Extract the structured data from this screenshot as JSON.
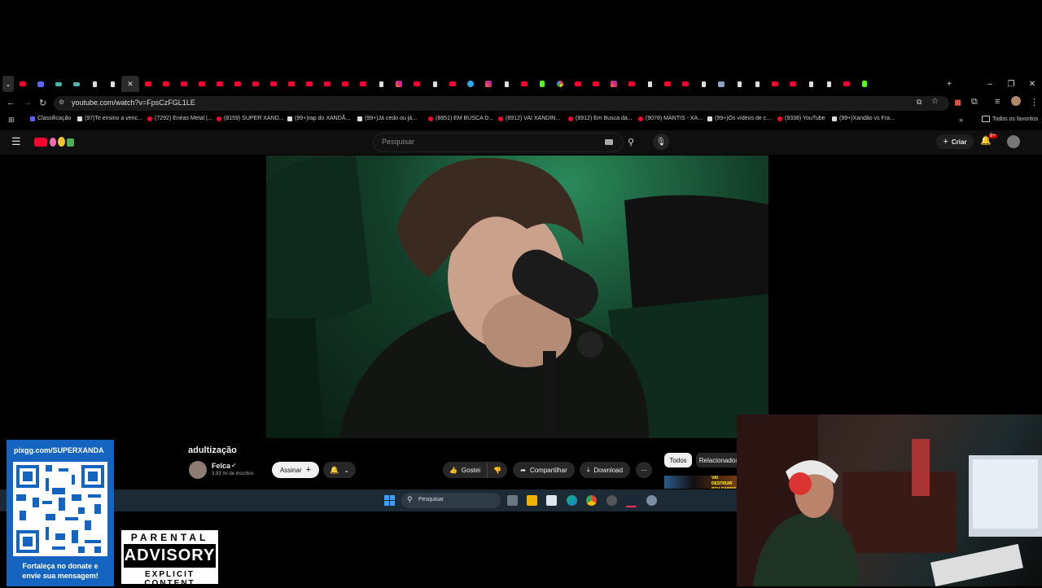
{
  "browser": {
    "tabs": [
      "yt",
      "dc",
      "ed",
      "ed",
      "tt",
      "tt",
      "close",
      "yt",
      "yt",
      "yt",
      "yt",
      "yt",
      "yt",
      "yt",
      "yt",
      "yt",
      "yt",
      "yt",
      "yt",
      "yt",
      "tt",
      "ig",
      "yt",
      "tt",
      "yt",
      "tg",
      "ig",
      "tt",
      "yt",
      "k",
      "g",
      "yt",
      "yt",
      "ig",
      "yt",
      "tt",
      "yt",
      "yt",
      "tt",
      "ms",
      "tt",
      "tt",
      "yt",
      "yt",
      "tt",
      "tt",
      "yt",
      "k"
    ],
    "active_tab_glyph": "✕",
    "new_tab": "+",
    "window_controls": {
      "minimize": "–",
      "maximize": "❐",
      "close": "✕"
    },
    "url": "youtube.com/watch?v=FpsCzFGL1LE",
    "bookmarks": [
      {
        "icon": "dc",
        "label": "Classificação"
      },
      {
        "icon": "tt",
        "label": "(97)Te ensino a venc..."
      },
      {
        "icon": "yt",
        "label": "(7292) Enéas Metal |..."
      },
      {
        "icon": "yt",
        "label": "(8159) SUPER XAND..."
      },
      {
        "icon": "tt",
        "label": "(99+)rap do XANDÃ..."
      },
      {
        "icon": "tt",
        "label": "(99+)Já cedo ou já..."
      },
      {
        "icon": "yt",
        "label": "(8851) EM BUSCA D..."
      },
      {
        "icon": "yt",
        "label": "(8912) VAI XANDIN..."
      },
      {
        "icon": "yt",
        "label": "(8912) Em Busca da..."
      },
      {
        "icon": "yt",
        "label": "(9078) MANTIS - XA..."
      },
      {
        "icon": "tt",
        "label": "(99+)Os vídeos de c..."
      },
      {
        "icon": "yt",
        "label": "(9338) YouTube"
      },
      {
        "icon": "tt",
        "label": "(99+)Xandão vs Fra..."
      }
    ],
    "bookmarks_overflow": "»",
    "all_bookmarks": "Todos os favoritos"
  },
  "youtube": {
    "search_placeholder": "Pesquisar",
    "create_label": "Criar",
    "notification_count": "9+",
    "video": {
      "title": "adultização",
      "channel": "Felca",
      "subscribers": "3,93 mi de inscritos",
      "subscribe_label": "Assinar",
      "like_label": "Gostei",
      "share_label": "Compartilhar",
      "download_label": "Download"
    },
    "chips": [
      "Todos",
      "Relacionados"
    ],
    "related_thumb_text": "VAI DESTRUIR SEU CARRO"
  },
  "taskbar": {
    "search_placeholder": "Pesquisar"
  },
  "overlays": {
    "pix_key": "pixgg.com/SUPERXANDA",
    "pix_note_line1": "Fortaleça no donate e",
    "pix_note_line2": "envie sua mensagem!",
    "advisory_top": "PARENTAL",
    "advisory_mid": "ADVISORY",
    "advisory_bottom": "EXPLICIT CONTENT"
  },
  "colors": {
    "youtube_red": "#ff0033",
    "pix_blue": "#1565c0",
    "taskbar": "#1c2a36"
  }
}
